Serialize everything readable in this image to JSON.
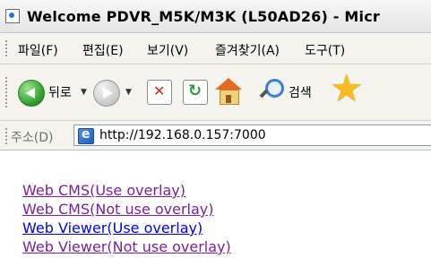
{
  "window": {
    "title": "Welcome PDVR_M5K/M3K (L50AD26) - Micr"
  },
  "menu": {
    "items": [
      {
        "label": "파일(F)"
      },
      {
        "label": "편집(E)"
      },
      {
        "label": "보기(V)"
      },
      {
        "label": "즐겨찾기(A)"
      },
      {
        "label": "도구(T)"
      }
    ]
  },
  "toolbar": {
    "back_label": "뒤로",
    "search_label": "검색",
    "icons": [
      "back-icon",
      "forward-icon",
      "stop-icon",
      "refresh-icon",
      "home-icon",
      "search-icon",
      "favorites-icon"
    ]
  },
  "address": {
    "label": "주소(D)",
    "url": "http://192.168.0.157:7000"
  },
  "content": {
    "links": [
      {
        "text": "Web CMS(Use overlay)",
        "visited": true
      },
      {
        "text": "Web CMS(Not use overlay)",
        "visited": true
      },
      {
        "text": "Web Viewer(Use overlay)",
        "visited": false
      },
      {
        "text": "Web Viewer(Not use overlay)",
        "visited": true
      }
    ]
  },
  "colors": {
    "link": "#0000ee",
    "visited_link": "#7b1fa2"
  }
}
